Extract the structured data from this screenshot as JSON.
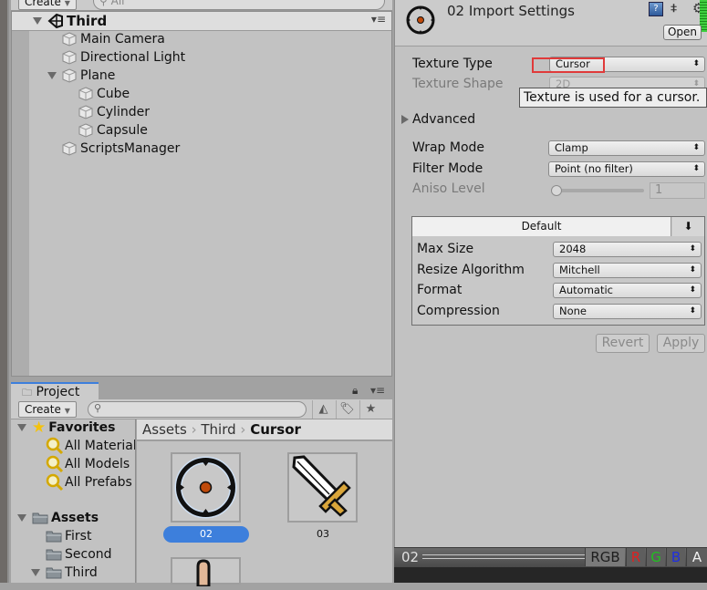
{
  "hierarchy": {
    "create_label": "Create",
    "search_placeholder": "All",
    "scene_name": "Third",
    "items": [
      {
        "label": "Main Camera",
        "depth": 1,
        "expandable": false
      },
      {
        "label": "Directional Light",
        "depth": 1,
        "expandable": false
      },
      {
        "label": "Plane",
        "depth": 1,
        "expandable": true
      },
      {
        "label": "Cube",
        "depth": 2,
        "expandable": false
      },
      {
        "label": "Cylinder",
        "depth": 2,
        "expandable": false
      },
      {
        "label": "Capsule",
        "depth": 2,
        "expandable": false
      },
      {
        "label": "ScriptsManager",
        "depth": 1,
        "expandable": false
      }
    ]
  },
  "project": {
    "tab_label": "Project",
    "create_label": "Create",
    "search_placeholder": "",
    "favorites": {
      "label": "Favorites",
      "items": [
        "All Materials",
        "All Models",
        "All Prefabs"
      ]
    },
    "assets": {
      "label": "Assets",
      "items": [
        "First",
        "Second",
        "Third"
      ]
    },
    "breadcrumb": [
      "Assets",
      "Third",
      "Cursor"
    ],
    "breadcrumb_sep": "›",
    "thumbnails": [
      {
        "label": "02",
        "icon": "crosshair-cursor-icon",
        "selected": true
      },
      {
        "label": "03",
        "icon": "sword-cursor-icon",
        "selected": false
      },
      {
        "label": "",
        "icon": "hand-cursor-icon",
        "selected": false
      }
    ]
  },
  "inspector": {
    "title": "02 Import Settings",
    "open_label": "Open",
    "texture_type_label": "Texture Type",
    "texture_type_value": "Cursor",
    "texture_shape_label": "Texture Shape",
    "texture_shape_value": "2D",
    "tooltip": "Texture is used for a cursor.",
    "advanced_label": "Advanced",
    "wrap_mode_label": "Wrap Mode",
    "wrap_mode_value": "Clamp",
    "filter_mode_label": "Filter Mode",
    "filter_mode_value": "Point (no filter)",
    "aniso_label": "Aniso Level",
    "aniso_value": "1",
    "platform_tab": "Default",
    "max_size_label": "Max Size",
    "max_size_value": "2048",
    "resize_label": "Resize Algorithm",
    "resize_value": "Mitchell",
    "format_label": "Format",
    "format_value": "Automatic",
    "compression_label": "Compression",
    "compression_value": "None",
    "revert_label": "Revert",
    "apply_label": "Apply"
  },
  "preview": {
    "name": "02",
    "channels": [
      {
        "label": "RGB",
        "color": "#1e1e1e"
      },
      {
        "label": "R",
        "color": "#e02020"
      },
      {
        "label": "G",
        "color": "#20c020"
      },
      {
        "label": "B",
        "color": "#2030e0"
      },
      {
        "label": "A",
        "color": "#f0f0f0"
      }
    ]
  },
  "colors": {
    "selection": "#3d7fdc",
    "highlight_box": "#e03a3a"
  }
}
